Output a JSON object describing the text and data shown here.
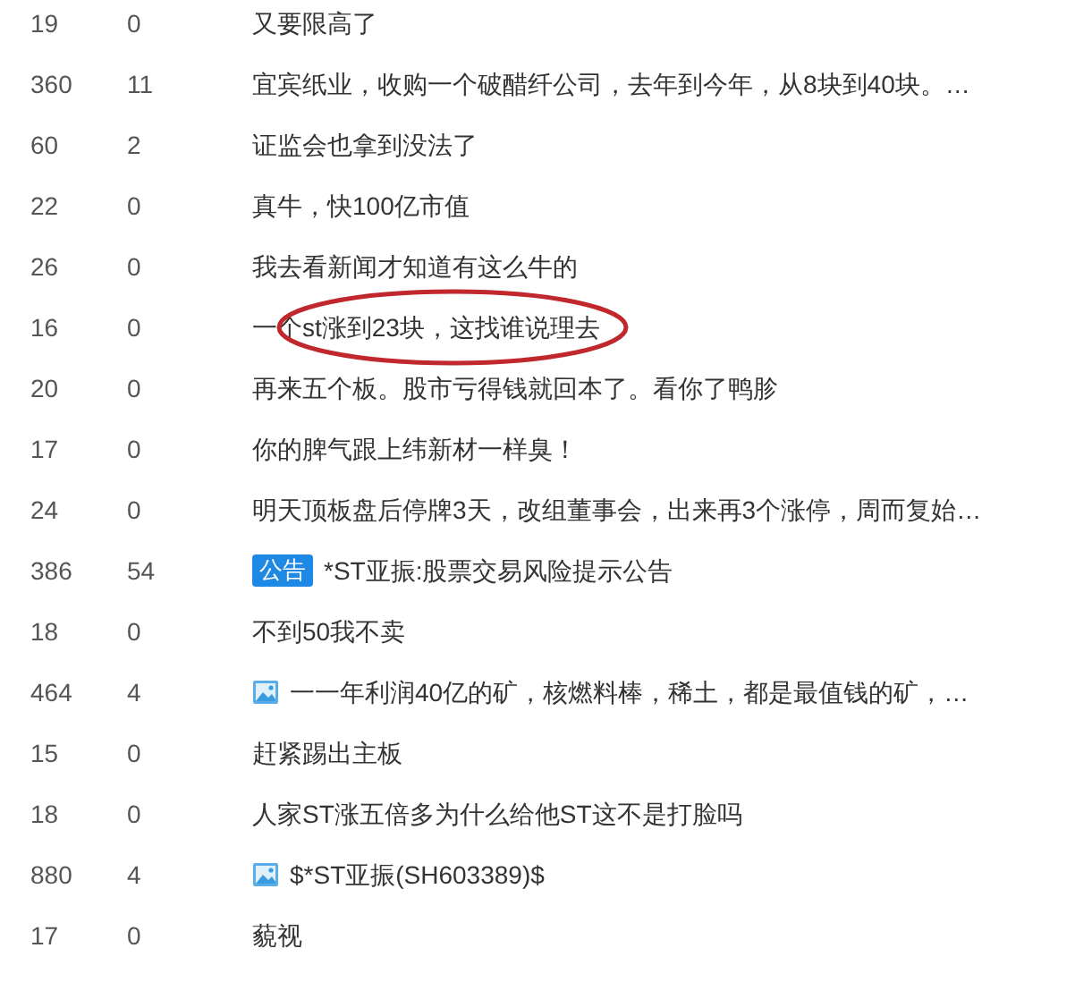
{
  "rows": [
    {
      "reads": "19",
      "comments": "0",
      "kind": "text",
      "title": "又要限高了",
      "circled": false
    },
    {
      "reads": "360",
      "comments": "11",
      "kind": "text",
      "title": "宜宾纸业，收购一个破醋纤公司，去年到今年，从8块到40块。…",
      "circled": false
    },
    {
      "reads": "60",
      "comments": "2",
      "kind": "text",
      "title": "证监会也拿到没法了",
      "circled": false
    },
    {
      "reads": "22",
      "comments": "0",
      "kind": "text",
      "title": "真牛，快100亿市值",
      "circled": false
    },
    {
      "reads": "26",
      "comments": "0",
      "kind": "text",
      "title": "我去看新闻才知道有这么牛的",
      "circled": false
    },
    {
      "reads": "16",
      "comments": "0",
      "kind": "text",
      "title": "一个st涨到23块，这找谁说理去",
      "circled": true
    },
    {
      "reads": "20",
      "comments": "0",
      "kind": "text",
      "title": "再来五个板。股市亏得钱就回本了。看你了鸭胗",
      "circled": false
    },
    {
      "reads": "17",
      "comments": "0",
      "kind": "text",
      "title": "你的脾气跟上纬新材一样臭！",
      "circled": false
    },
    {
      "reads": "24",
      "comments": "0",
      "kind": "text",
      "title": "明天顶板盘后停牌3天，改组董事会，出来再3个涨停，周而复始…",
      "circled": false
    },
    {
      "reads": "386",
      "comments": "54",
      "kind": "notice",
      "tag": "公告",
      "title": "*ST亚振:股票交易风险提示公告",
      "circled": false
    },
    {
      "reads": "18",
      "comments": "0",
      "kind": "text",
      "title": "不到50我不卖",
      "circled": false
    },
    {
      "reads": "464",
      "comments": "4",
      "kind": "image",
      "title": "一一年利润40亿的矿，核燃料棒，稀土，都是最值钱的矿，…",
      "circled": false
    },
    {
      "reads": "15",
      "comments": "0",
      "kind": "text",
      "title": "赶紧踢出主板",
      "circled": false
    },
    {
      "reads": "18",
      "comments": "0",
      "kind": "text",
      "title": "人家ST涨五倍多为什么给他ST这不是打脸吗",
      "circled": false
    },
    {
      "reads": "880",
      "comments": "4",
      "kind": "image",
      "title": "$*ST亚振(SH603389)$",
      "circled": false
    },
    {
      "reads": "17",
      "comments": "0",
      "kind": "text",
      "title": "藐视",
      "circled": false
    }
  ]
}
